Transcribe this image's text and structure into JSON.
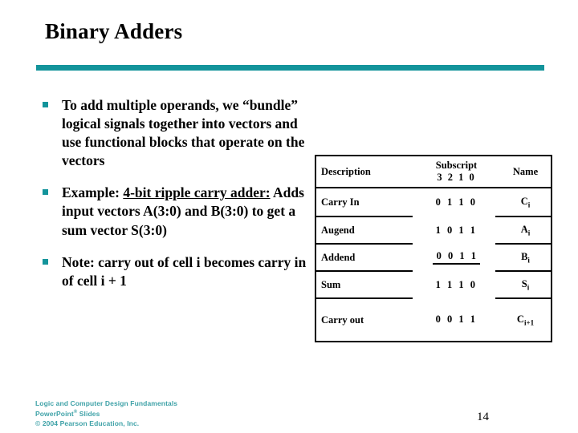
{
  "slide": {
    "title": "Binary Adders",
    "page_number": "14",
    "accent_color": "#13949b",
    "footer_color": "#2e9aa0"
  },
  "bullets": [
    {
      "parts": [
        {
          "text": "To  add multiple operands, we “bundle” logical signals together into vectors and use functional blocks that operate on the vectors",
          "underline": false
        }
      ]
    },
    {
      "parts": [
        {
          "text": "Example: ",
          "underline": false
        },
        {
          "text": "4-bit ripple carry adder:",
          "underline": true
        },
        {
          "text": "  Adds input vectors A(3:0) and B(3:0) to get a sum  vector S(3:0)",
          "underline": false
        }
      ]
    },
    {
      "parts": [
        {
          "text": "Note: carry out of cell i becomes carry in of cell i + 1",
          "underline": false
        }
      ]
    }
  ],
  "table": {
    "headers": {
      "description": "Description",
      "subscript_line1": "Subscript",
      "subscript_line2": "3 2 1 0",
      "name": "Name"
    },
    "rows": [
      {
        "description": "Carry In",
        "bits": "0 1 1 0",
        "ruled": false,
        "name_base": "C",
        "name_sub": "i"
      },
      {
        "description": "Augend",
        "bits": "1 0 1 1",
        "ruled": false,
        "name_base": "A",
        "name_sub": "i"
      },
      {
        "description": "Addend",
        "bits": "0 0 1 1",
        "ruled": true,
        "name_base": "B",
        "name_sub": "i"
      },
      {
        "description": "Sum",
        "bits": "1 1 1 0",
        "ruled": false,
        "name_base": "S",
        "name_sub": "i"
      },
      {
        "description": "Carry out",
        "bits": "0 0 1 1",
        "ruled": false,
        "name_base": "C",
        "name_sub": "i+1"
      }
    ]
  },
  "footer": {
    "line1": "Logic and Computer Design Fundamentals",
    "line2_pre": "PowerPoint",
    "line2_sup": "®",
    "line2_post": " Slides",
    "line3": "© 2004 Pearson Education, Inc."
  }
}
